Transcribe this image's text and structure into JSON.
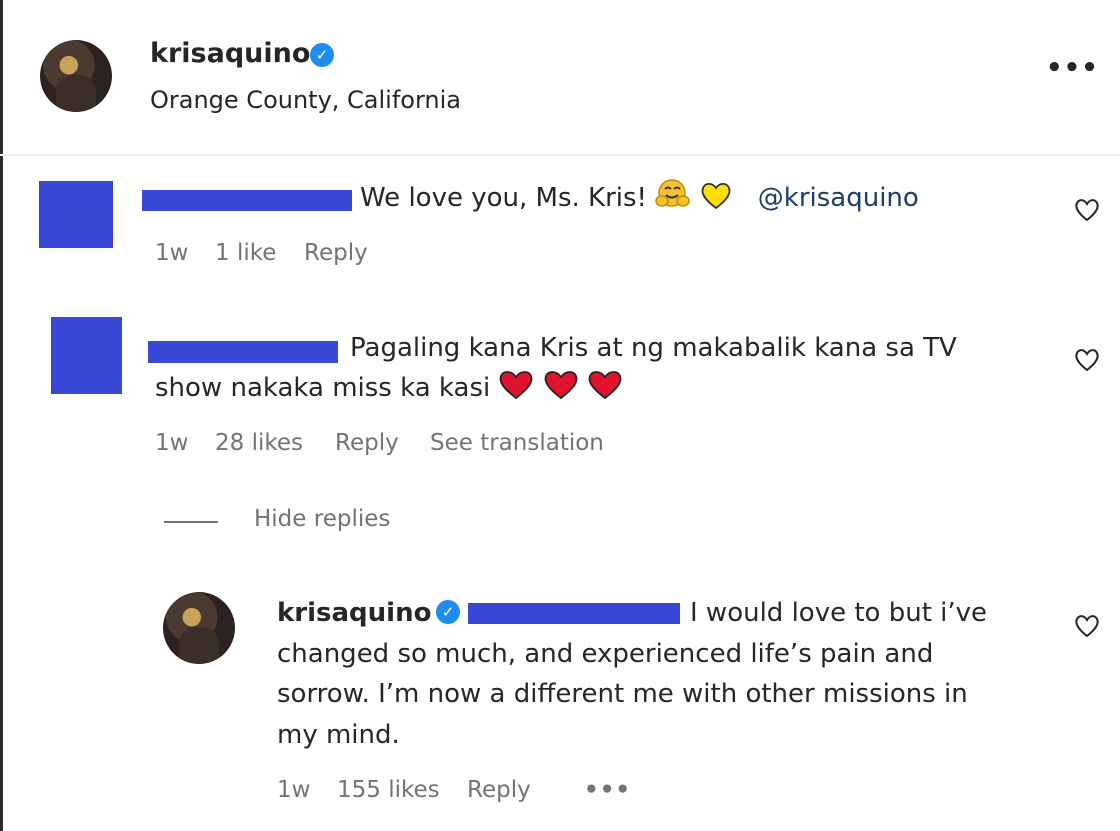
{
  "post": {
    "username": "krisaquino",
    "location": "Orange County, California",
    "more_label": "•••"
  },
  "comments": [
    {
      "text": "We love you, Ms. Kris!",
      "mention": "@krisaquino",
      "time": "1w",
      "likes": "1 like",
      "reply_label": "Reply"
    },
    {
      "text_line1": "Pagaling kana Kris at ng makabalik kana sa TV",
      "text_line2": "show nakaka miss ka kasi",
      "time": "1w",
      "likes": "28 likes",
      "reply_label": "Reply",
      "translate_label": "See translation"
    }
  ],
  "hide_replies_label": "Hide replies",
  "reply": {
    "username": "krisaquino",
    "line1": "I would love to but i’ve",
    "line2": "changed so much, and experienced life’s pain and",
    "line3": "sorrow. I’m now a different me with other missions in",
    "line4": "my mind.",
    "time": "1w",
    "likes": "155 likes",
    "reply_label": "Reply",
    "more_label": "•••"
  },
  "colors": {
    "redaction": "#3a48d6",
    "verified": "#1f8cf0",
    "heart_red": "#e0142e",
    "mention": "#1b3f6b"
  }
}
